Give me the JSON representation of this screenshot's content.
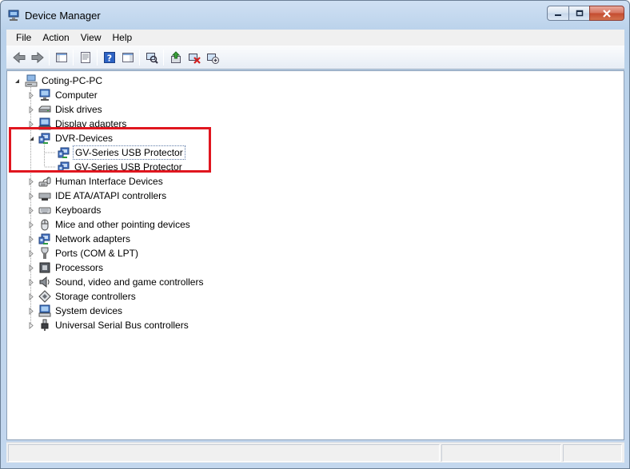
{
  "window": {
    "title": "Device Manager"
  },
  "menu": [
    "File",
    "Action",
    "View",
    "Help"
  ],
  "toolbar": [
    {
      "icon": "back-arrow-icon"
    },
    {
      "icon": "forward-arrow-icon"
    },
    {
      "icon": "show-hide-console-tree-icon"
    },
    {
      "icon": "properties-icon"
    },
    {
      "icon": "help-icon"
    },
    {
      "icon": "show-hide-action-pane-icon"
    },
    {
      "icon": "scan-hardware-changes-icon"
    },
    {
      "icon": "update-driver-icon"
    },
    {
      "icon": "uninstall-device-icon"
    },
    {
      "icon": "disable-device-icon"
    }
  ],
  "tree": {
    "root": {
      "label": "Coting-PC-PC",
      "icon": "computer-root-icon",
      "expanded": true
    },
    "categories": [
      {
        "label": "Computer",
        "icon": "computer-icon",
        "expanded": false
      },
      {
        "label": "Disk drives",
        "icon": "disk-drive-icon",
        "expanded": false
      },
      {
        "label": "Display adapters",
        "icon": "display-adapter-icon",
        "expanded": false
      },
      {
        "label": "DVR-Devices",
        "icon": "network-device-icon",
        "expanded": true,
        "children": [
          {
            "label": "GV-Series USB Protector",
            "icon": "network-device-icon",
            "selected": true
          },
          {
            "label": "GV-Series USB Protector",
            "icon": "network-device-icon",
            "selected": false
          }
        ]
      },
      {
        "label": "Human Interface Devices",
        "icon": "hid-icon",
        "expanded": false
      },
      {
        "label": "IDE ATA/ATAPI controllers",
        "icon": "ide-controller-icon",
        "expanded": false
      },
      {
        "label": "Keyboards",
        "icon": "keyboard-icon",
        "expanded": false
      },
      {
        "label": "Mice and other pointing devices",
        "icon": "mouse-icon",
        "expanded": false
      },
      {
        "label": "Network adapters",
        "icon": "network-adapter-icon",
        "expanded": false
      },
      {
        "label": "Ports (COM & LPT)",
        "icon": "port-icon",
        "expanded": false
      },
      {
        "label": "Processors",
        "icon": "processor-icon",
        "expanded": false
      },
      {
        "label": "Sound, video and game controllers",
        "icon": "speaker-icon",
        "expanded": false
      },
      {
        "label": "Storage controllers",
        "icon": "storage-controller-icon",
        "expanded": false
      },
      {
        "label": "System devices",
        "icon": "system-device-icon",
        "expanded": false
      },
      {
        "label": "Universal Serial Bus controllers",
        "icon": "usb-icon",
        "expanded": false
      }
    ]
  },
  "annotation": {
    "color": "#e0161f"
  }
}
